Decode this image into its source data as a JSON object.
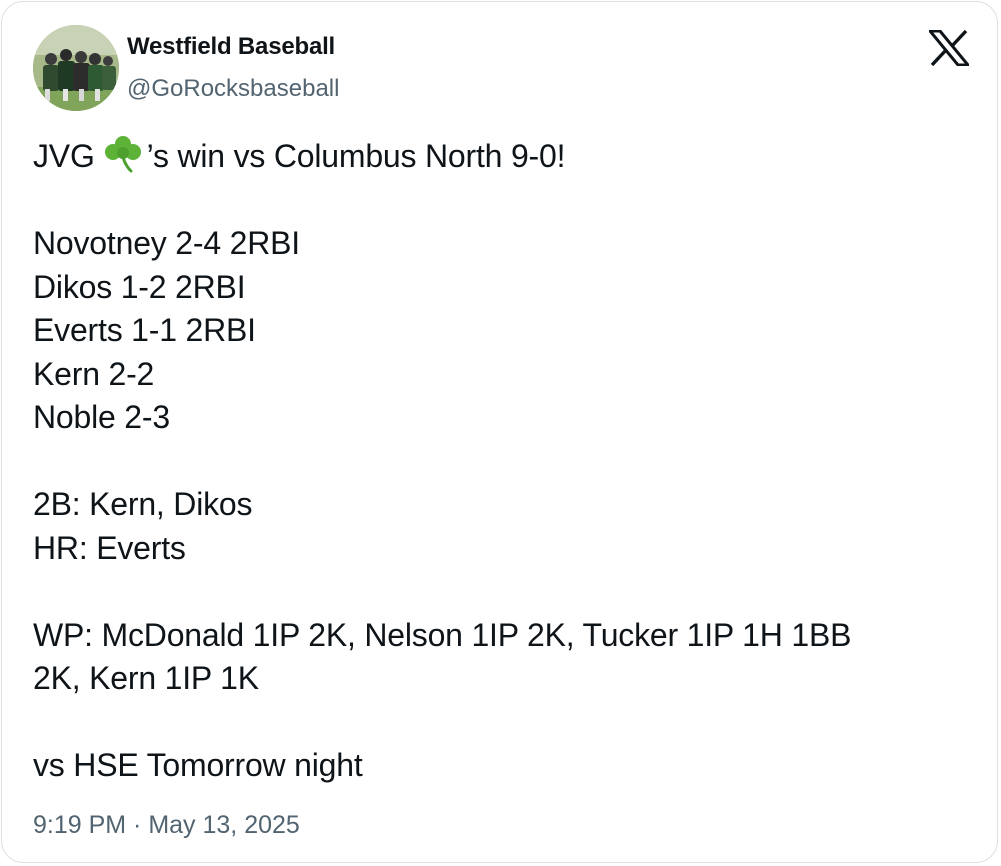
{
  "account": {
    "display_name": "Westfield Baseball",
    "handle": "@GoRocksbaseball"
  },
  "brand_icon": "x-logo-icon",
  "tweet": {
    "intro_prefix": "JVG",
    "intro_emoji": "shamrock-icon",
    "intro_suffix": "’s win vs Columbus North 9-0!",
    "batting": [
      "Novotney 2-4 2RBI",
      "Dikos 1-2 2RBI",
      "Everts 1-1 2RBI",
      "Kern 2-2",
      "Noble 2-3"
    ],
    "extra_base": [
      "2B: Kern, Dikos",
      "HR: Everts"
    ],
    "pitching": [
      "WP: McDonald 1IP 2K, Nelson 1IP 2K, Tucker 1IP 1H 1BB",
      "2K, Kern 1IP 1K"
    ],
    "closing": "vs HSE Tomorrow night"
  },
  "timestamp": "9:19 PM · May 13, 2025",
  "colors": {
    "text_primary": "#0f1419",
    "text_secondary": "#536471",
    "shamrock_green": "#5cb338",
    "border": "#dcdfe3"
  }
}
